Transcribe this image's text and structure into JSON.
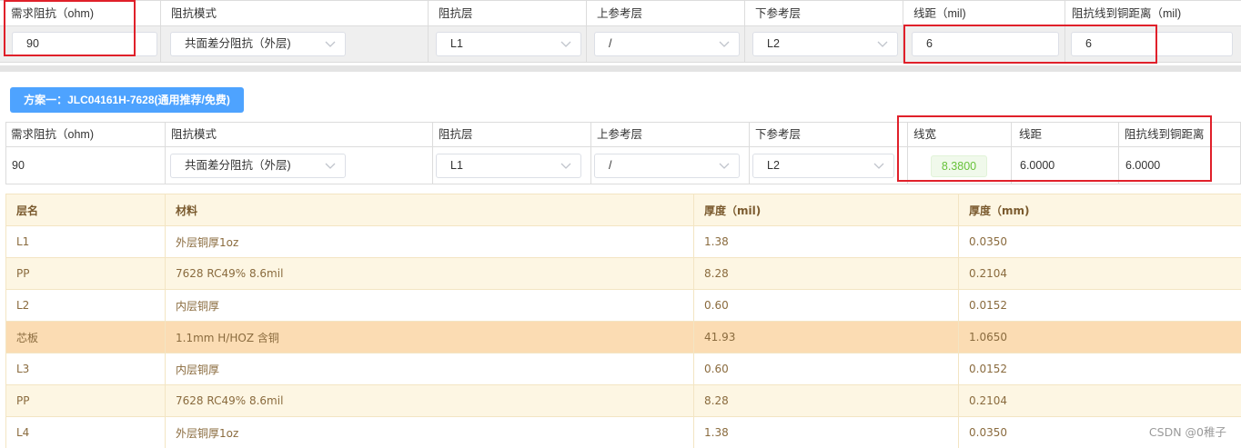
{
  "input_table": {
    "headers": [
      "需求阻抗（ohm)",
      "阻抗模式",
      "阻抗层",
      "上参考层",
      "下参考层",
      "线距（mil)",
      "阻抗线到铜距离（mil)"
    ],
    "impedance_value": "90",
    "mode_value": "共面差分阻抗（外层)",
    "impedance_layer_value": "L1",
    "upper_ref_value": "/",
    "lower_ref_value": "L2",
    "spacing_value": "6",
    "copper_distance_value": "6"
  },
  "plan_button": {
    "label": "方案一：JLC04161H-7628(通用推荐/免费)"
  },
  "result_table": {
    "headers": [
      "需求阻抗（ohm)",
      "阻抗模式",
      "阻抗层",
      "上参考层",
      "下参考层",
      "线宽",
      "线距",
      "阻抗线到铜距离"
    ],
    "impedance_value": "90",
    "mode_value": "共面差分阻抗（外层)",
    "impedance_layer_value": "L1",
    "upper_ref_value": "/",
    "lower_ref_value": "L2",
    "line_width_value": "8.3800",
    "spacing_value": "6.0000",
    "copper_distance_value": "6.0000"
  },
  "layer_table": {
    "headers": [
      "层名",
      "材料",
      "厚度（mil)",
      "厚度（mm)"
    ],
    "rows": [
      [
        "L1",
        "外层铜厚1oz",
        "1.38",
        "0.0350"
      ],
      [
        "PP",
        "7628 RC49% 8.6mil",
        "8.28",
        "0.2104"
      ],
      [
        "L2",
        "内层铜厚",
        "0.60",
        "0.0152"
      ],
      [
        "芯板",
        "1.1mm H/HOZ 含铜",
        "41.93",
        "1.0650"
      ],
      [
        "L3",
        "内层铜厚",
        "0.60",
        "0.0152"
      ],
      [
        "PP",
        "7628 RC49% 8.6mil",
        "8.28",
        "0.2104"
      ],
      [
        "L4",
        "外层铜厚1oz",
        "1.38",
        "0.0350"
      ]
    ]
  },
  "watermark": "CSDN @0稚子",
  "colors": {
    "accent_button": "#4ea3ff",
    "highlight_box": "#e0202a",
    "result_tag_text": "#67c23a",
    "layer_row_alt": "#fdf6e3",
    "core_row": "#fbdcb3"
  },
  "icons": {
    "select_arrow": "chevron-down-icon"
  }
}
